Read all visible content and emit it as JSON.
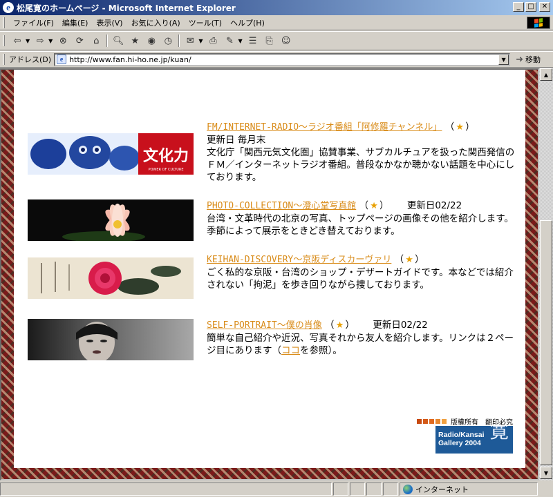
{
  "window": {
    "title": "松尾寛のホームページ - Microsoft Internet Explorer"
  },
  "menu": [
    "ファイル(F)",
    "編集(E)",
    "表示(V)",
    "お気に入り(A)",
    "ツール(T)",
    "ヘルプ(H)"
  ],
  "address": {
    "label": "アドレス(D)",
    "url": "http://www.fan.hi-ho.ne.jp/kuan/",
    "go_label": "移動"
  },
  "entries": [
    {
      "link": "FM/INTERNET-RADIO～ラジオ番組「阿修羅チャンネル」",
      "updated": "更新日 毎月末",
      "description": "文化庁「関西元気文化圏」協賛事業、サブカルチュアを扱った関西発信のＦＭ／インターネットラジオ番組。普段なかなか聴かない話題を中心にしております。",
      "image_caption": "文化力",
      "image_subcaption": "POWER OF CULTURE"
    },
    {
      "link": "PHOTO-COLLECTION～澄心堂写真館",
      "updated": "更新日02/22",
      "description": "台湾・文革時代の北京の写真、トップページの画像その他を紹介します。季節によって展示をときどき替えております。"
    },
    {
      "link": "KEIHAN-DISCOVERY～京阪ディスカーヴァリ",
      "updated": "",
      "description": "ごく私的な京阪・台湾のショップ・デザートガイドです。本などでは紹介されない「拘泥」を歩き回りながら捜しております。"
    },
    {
      "link": "SELF-PORTRAIT～僕の肖像",
      "updated": "更新日02/22",
      "description_before": "簡単な自己紹介や近況、写真それから友人を紹介します。リンクは２ページ目にあります（",
      "description_link": "ココ",
      "description_after": "を参照）。"
    }
  ],
  "footer": {
    "copyright": "版權所有　翻印必究",
    "badge_line1": "Radio/Kansai",
    "badge_line2": "Gallery 2004",
    "badge_kanji": "寛"
  },
  "status": {
    "zone": "インターネット"
  },
  "colors": {
    "link": "#d98c1a",
    "star": "#e8a000",
    "titlebar": "#0a246a",
    "badge": "#1e5a98"
  }
}
